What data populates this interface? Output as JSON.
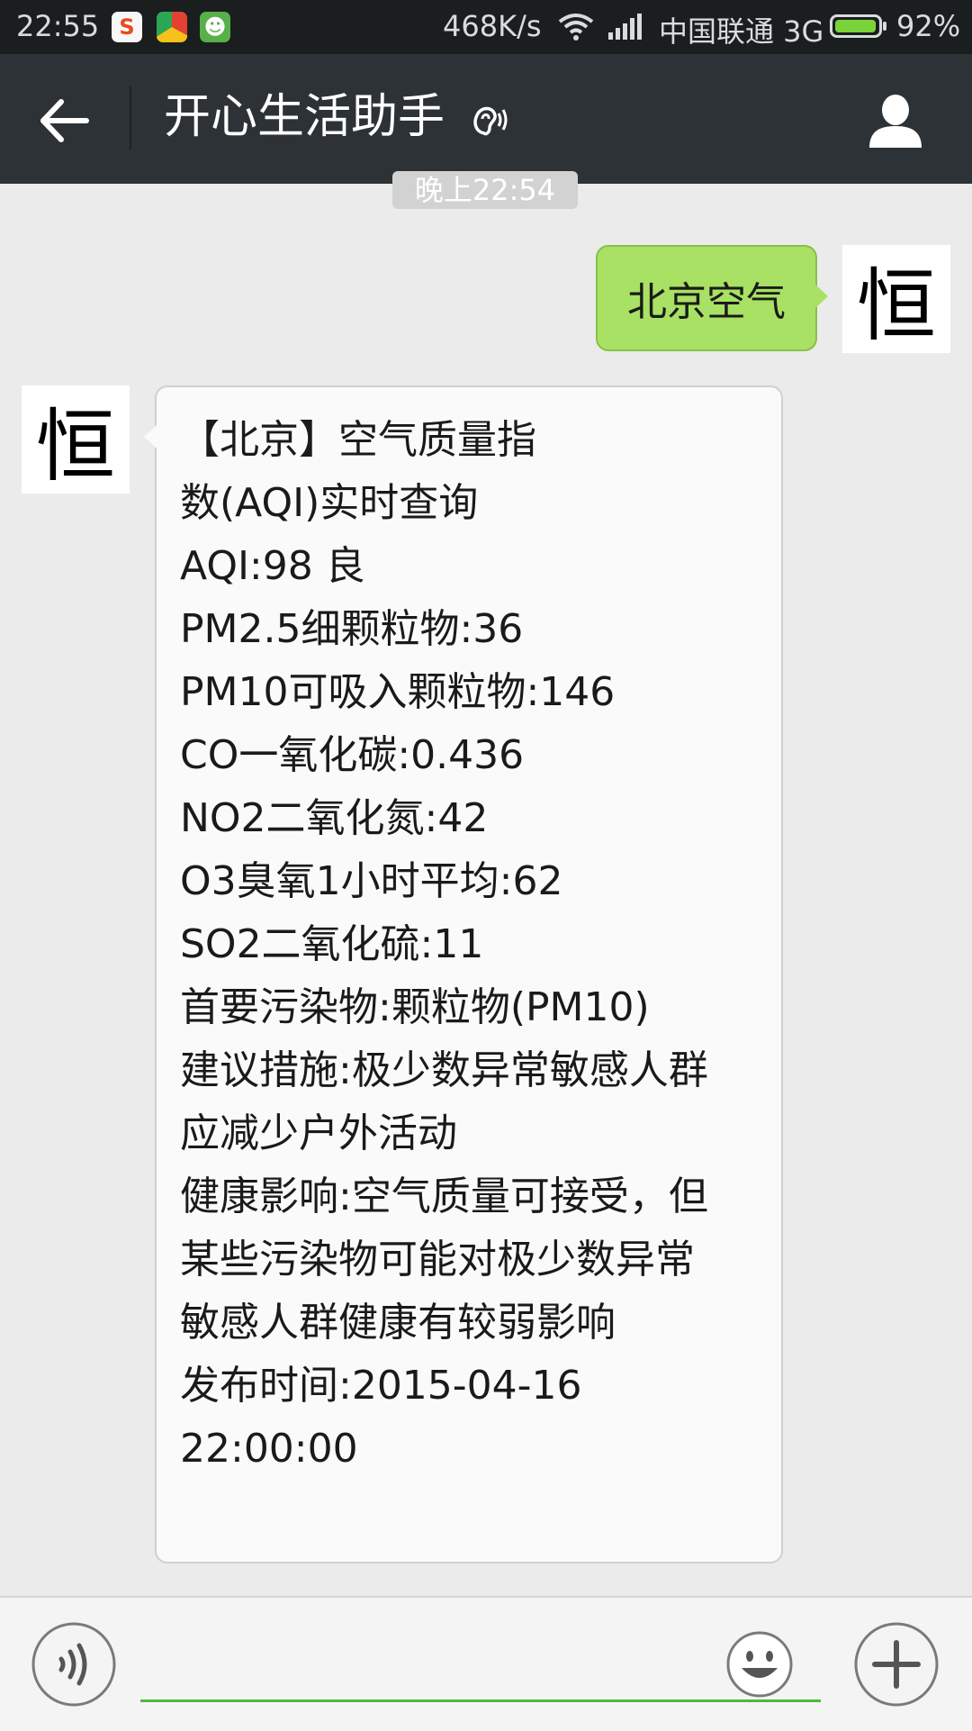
{
  "status_bar": {
    "time": "22:55",
    "net_speed": "468K/s",
    "carrier": "中国联通 3G",
    "battery_percent": "92%",
    "battery_level": 0.92,
    "app_icons": [
      "sogou-icon",
      "chrome-icon",
      "android-icon"
    ]
  },
  "header": {
    "title": "开心生活助手",
    "back_icon": "arrow-left-icon",
    "mode_icon": "ear-icon",
    "profile_icon": "person-icon"
  },
  "chat": {
    "timestamp": "晚上22:54",
    "avatar_char": "恒",
    "outgoing": {
      "text": "北京空气"
    },
    "incoming": {
      "lines": [
        "【北京】空气质量指",
        "数(AQI)实时查询",
        "AQI:98 良",
        "PM2.5细颗粒物:36",
        "PM10可吸入颗粒物:146",
        "CO一氧化碳:0.436",
        "NO2二氧化氮:42",
        "O3臭氧1小时平均:62",
        "SO2二氧化硫:11",
        "首要污染物:颗粒物(PM10)",
        "建议措施:极少数异常敏感人群",
        "应减少户外活动",
        "健康影响:空气质量可接受，但",
        "某些污染物可能对极少数异常",
        "敏感人群健康有较弱影响",
        "发布时间:2015-04-16",
        "22:00:00"
      ]
    }
  },
  "input_bar": {
    "value": "",
    "voice_icon": "voice-icon",
    "emoji_icon": "smiley-icon",
    "more_icon": "plus-icon"
  },
  "colors": {
    "status_bar_bg": "#1a1e1f",
    "header_bg": "#2d3236",
    "chat_bg": "#ebebeb",
    "outgoing_bubble": "#a8e163",
    "incoming_bubble": "#fafafa",
    "input_underline": "#4cba3a"
  }
}
